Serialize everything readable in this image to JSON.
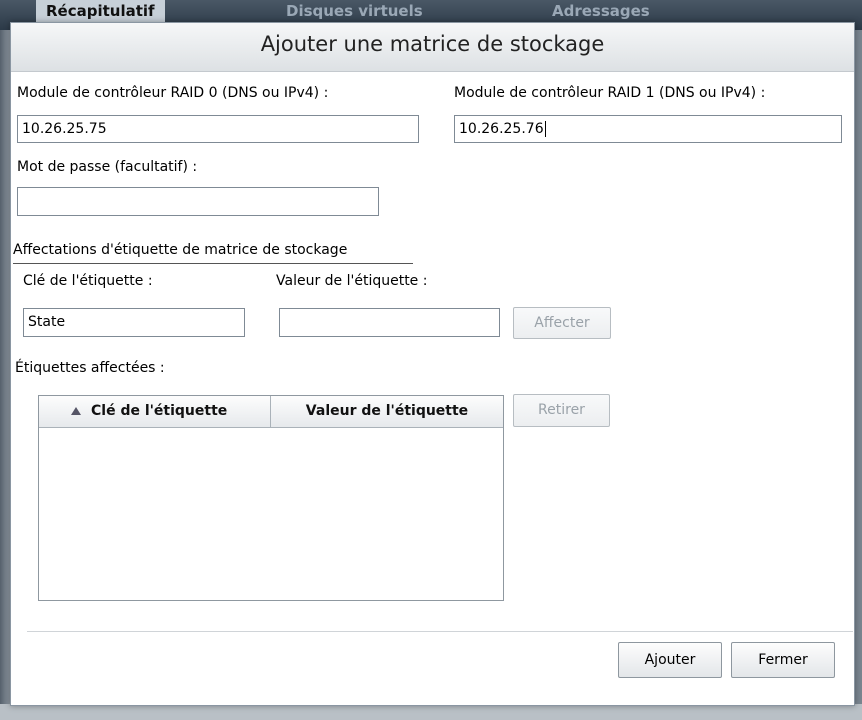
{
  "background": {
    "tabs": [
      "Récapitulatif",
      "Disques virtuels",
      "Adressages"
    ]
  },
  "dialog": {
    "title": "Ajouter une matrice de stockage",
    "raid0": {
      "label": "Module de contrôleur RAID 0 (DNS ou IPv4) :",
      "value": "10.26.25.75"
    },
    "raid1": {
      "label": "Module de contrôleur RAID 1 (DNS ou IPv4) :",
      "value": "10.26.25.76"
    },
    "password": {
      "label": "Mot de passe (facultatif) :",
      "value": ""
    },
    "tags_section": {
      "title": "Affectations d'étiquette de matrice de stockage",
      "key_label": "Clé de l'étiquette :",
      "key_value": "State",
      "value_label": "Valeur de l'étiquette :",
      "value_value": "",
      "assign_button": "Affecter",
      "assigned_label": "Étiquettes affectées :",
      "table": {
        "columns": [
          "Clé de l'étiquette",
          "Valeur de l'étiquette"
        ],
        "rows": []
      },
      "remove_button": "Retirer"
    },
    "buttons": {
      "add": "Ajouter",
      "close": "Fermer"
    }
  }
}
